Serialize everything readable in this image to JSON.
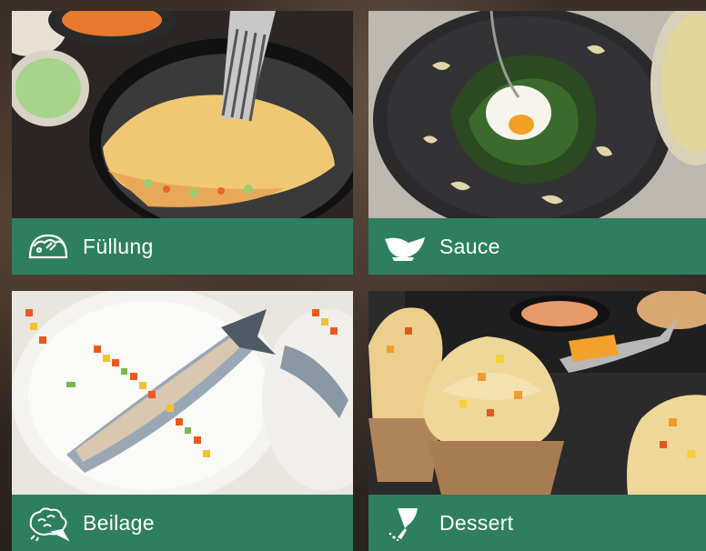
{
  "tiles": [
    {
      "label": "Füllung",
      "icon": "taco-icon",
      "image": "omelette in pan with filling"
    },
    {
      "label": "Sauce",
      "icon": "gravy-boat-icon",
      "image": "poached egg on spinach with sauce"
    },
    {
      "label": "Beilage",
      "icon": "vegetables-icon",
      "image": "herring fillets with diced vegetables"
    },
    {
      "label": "Dessert",
      "icon": "piping-bag-icon",
      "image": "cupcakes with cream frosting"
    }
  ],
  "colors": {
    "bar": "#2e7f5f",
    "text": "#ffffff"
  }
}
